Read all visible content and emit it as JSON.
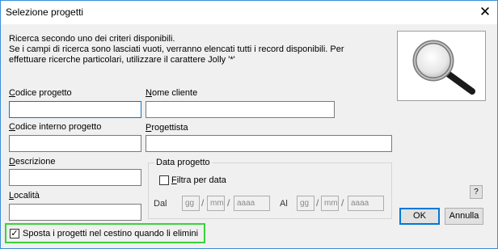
{
  "window": {
    "title": "Selezione progetti",
    "close_glyph": "✕"
  },
  "intro": {
    "line1": "Ricerca secondo uno dei criteri disponibili.",
    "line2": "Se i campi di ricerca sono lasciati vuoti, verranno elencati tutti i record disponibili. Per",
    "line3": "effettuare ricerche particolari, utilizzare il carattere Jolly '*'"
  },
  "fields": {
    "codice_progetto": {
      "label_first": "C",
      "label_rest": "odice progetto",
      "value": ""
    },
    "nome_cliente": {
      "label_first": "N",
      "label_rest": "ome cliente",
      "value": ""
    },
    "codice_interno": {
      "label_first": "C",
      "label_rest": "odice interno progetto",
      "value": ""
    },
    "progettista": {
      "label_first": "P",
      "label_rest": "rogettista",
      "value": ""
    },
    "descrizione": {
      "label_first": "D",
      "label_rest": "escrizione",
      "value": ""
    },
    "localita": {
      "label_first": "L",
      "label_rest": "ocalità",
      "value": ""
    }
  },
  "data_progetto": {
    "title": "Data progetto",
    "filter_label_first": "F",
    "filter_label_rest": "iltra per data",
    "filter_checked": false,
    "dal_label": "Dal",
    "al_label": "Al",
    "dd_placeholder": "gg",
    "mm_placeholder": "mm",
    "yyyy_placeholder": "aaaa",
    "separator": "/"
  },
  "buttons": {
    "help": "?",
    "ok": "OK",
    "cancel": "Annulla"
  },
  "trash_option": {
    "label": "Sposta i progetti nel cestino quando li elimini",
    "checked": true,
    "check_glyph": "✓"
  },
  "icons": {
    "search_image": "magnifying-glass-icon"
  }
}
